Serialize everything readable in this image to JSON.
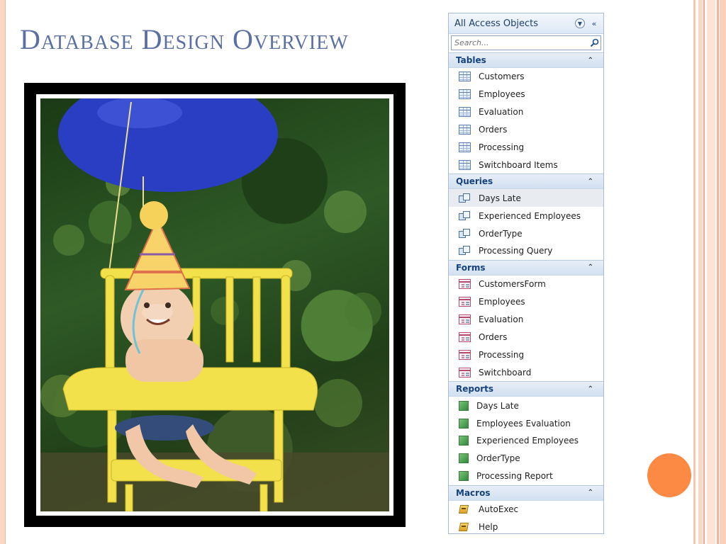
{
  "slide": {
    "title": "Database Design Overview",
    "accent_color": "#5a6fa3",
    "dot_color": "#fc8a45"
  },
  "pane": {
    "title": "All Access Objects",
    "search_placeholder": "Search...",
    "groups": {
      "tables": {
        "label": "Tables",
        "items": [
          "Customers",
          "Employees",
          "Evaluation",
          "Orders",
          "Processing",
          "Switchboard Items"
        ]
      },
      "queries": {
        "label": "Queries",
        "items": [
          "Days Late",
          "Experienced Employees",
          "OrderType",
          "Processing Query"
        ]
      },
      "forms": {
        "label": "Forms",
        "items": [
          "CustomersForm",
          "Employees",
          "Evaluation",
          "Orders",
          "Processing",
          "Switchboard"
        ]
      },
      "reports": {
        "label": "Reports",
        "items": [
          "Days Late",
          "Employees Evaluation",
          "Experienced Employees",
          "OrderType",
          "Processing Report"
        ]
      },
      "macros": {
        "label": "Macros",
        "items": [
          "AutoExec",
          "Help"
        ]
      }
    }
  }
}
